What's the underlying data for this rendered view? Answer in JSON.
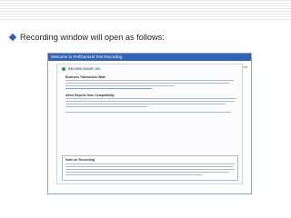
{
  "slide": {
    "bullet_text": "Recording window will open as follows:"
  },
  "window": {
    "title": "Welcome to PerfGeneral Test Recording",
    "brand": "Pagenuity Technologies",
    "record_label": "RECORD MODE: ON",
    "section1_title": "Business Transaction Walk",
    "section2_title": "Allow Reports from Compatibility",
    "box_title": "Note on Recording"
  }
}
